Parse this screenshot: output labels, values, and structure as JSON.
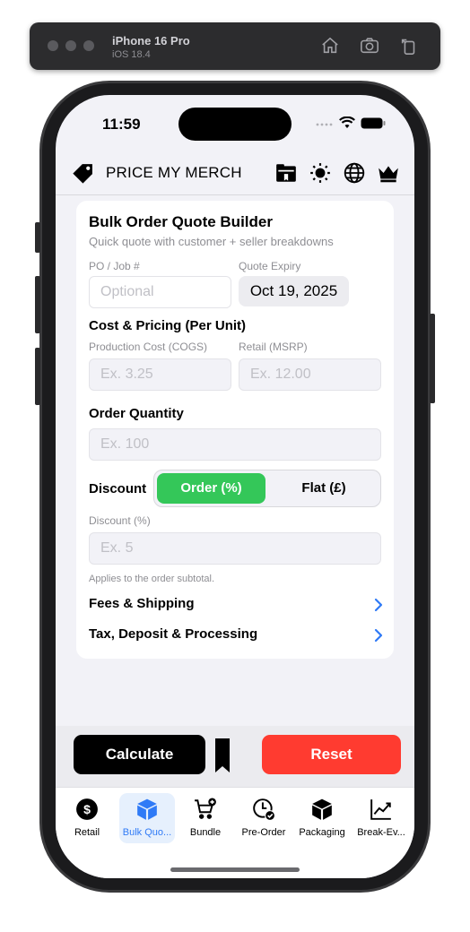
{
  "simulator": {
    "device": "iPhone 16 Pro",
    "os": "iOS 18.4",
    "icons": [
      "home-icon",
      "screenshot-icon",
      "rotate-icon"
    ]
  },
  "status_bar": {
    "time": "11:59"
  },
  "nav": {
    "title": "PRICE MY MERCH",
    "icons": [
      "tag-icon",
      "folder-icon",
      "brightness-icon",
      "globe-icon",
      "crown-icon"
    ]
  },
  "card": {
    "title": "Bulk Order Quote Builder",
    "subtitle": "Quick quote with customer + seller breakdowns",
    "po_label": "PO / Job #",
    "po_placeholder": "Optional",
    "expiry_label": "Quote Expiry",
    "expiry_value": "Oct 19, 2025",
    "cost_section": "Cost & Pricing (Per Unit)",
    "cogs_label": "Production Cost (COGS)",
    "cogs_placeholder": "Ex. 3.25",
    "msrp_label": "Retail (MSRP)",
    "msrp_placeholder": "Ex. 12.00",
    "qty_section": "Order Quantity",
    "qty_placeholder": "Ex. 100",
    "discount_label": "Discount",
    "discount_options": [
      "Order (%)",
      "Flat (£)"
    ],
    "discount_selected": "Order (%)",
    "discount_pct_label": "Discount (%)",
    "discount_placeholder": "Ex. 5",
    "discount_note": "Applies to the order subtotal.",
    "fees_row": "Fees & Shipping",
    "tax_row": "Tax, Deposit & Processing"
  },
  "actions": {
    "calculate": "Calculate",
    "reset": "Reset"
  },
  "tabs": [
    {
      "label": "Retail",
      "icon": "dollar-circle-icon"
    },
    {
      "label": "Bulk Quo...",
      "icon": "box-icon",
      "active": true
    },
    {
      "label": "Bundle",
      "icon": "cart-add-icon"
    },
    {
      "label": "Pre-Order",
      "icon": "clock-check-icon"
    },
    {
      "label": "Packaging",
      "icon": "package-icon"
    },
    {
      "label": "Break-Ev...",
      "icon": "chart-line-icon"
    }
  ],
  "colors": {
    "accent": "#2f7af6",
    "green": "#34c759",
    "red": "#ff3b30"
  }
}
